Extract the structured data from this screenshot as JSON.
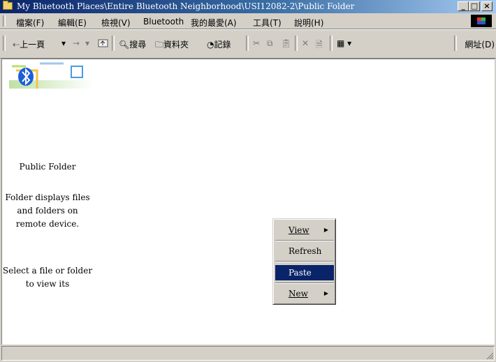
{
  "window": {
    "title": "My Bluetooth Places\\Entire Bluetooth Neighborhood\\USI12082-2\\Public Folder"
  },
  "caption_buttons": {
    "minimize": "_",
    "maximize": "□",
    "close": "×"
  },
  "menubar": {
    "items": [
      "檔案(F)",
      "編輯(E)",
      "檢視(V)",
      "Bluetooth",
      "我的最愛(A)",
      "工具(T)",
      "說明(H)"
    ]
  },
  "toolbar": {
    "back": "上一頁",
    "forward_arrow": "→",
    "dropdown_arrow": "▾",
    "search": "搜尋",
    "folders": "資料夾",
    "history": "記錄",
    "address_label": "網址(D)"
  },
  "content": {
    "folder_name": "Public Folder",
    "description_lines": [
      "Folder displays files",
      "and folders on",
      "remote device."
    ],
    "select_hint_lines": [
      "Select a file or folder",
      "to view its"
    ]
  },
  "context_menu": {
    "items": [
      {
        "label": "View",
        "has_submenu": true,
        "selected": false
      },
      {
        "label": "Refresh",
        "has_submenu": false,
        "selected": false
      },
      {
        "label": "Paste",
        "has_submenu": false,
        "selected": true
      },
      {
        "label": "New",
        "has_submenu": true,
        "selected": false
      }
    ],
    "submenu_arrow": "▶"
  },
  "colors": {
    "titlebar_start": "#0a246a",
    "titlebar_end": "#a6caf0",
    "selection": "#0a246a",
    "bluetooth_blue": "#1a5fd8"
  }
}
